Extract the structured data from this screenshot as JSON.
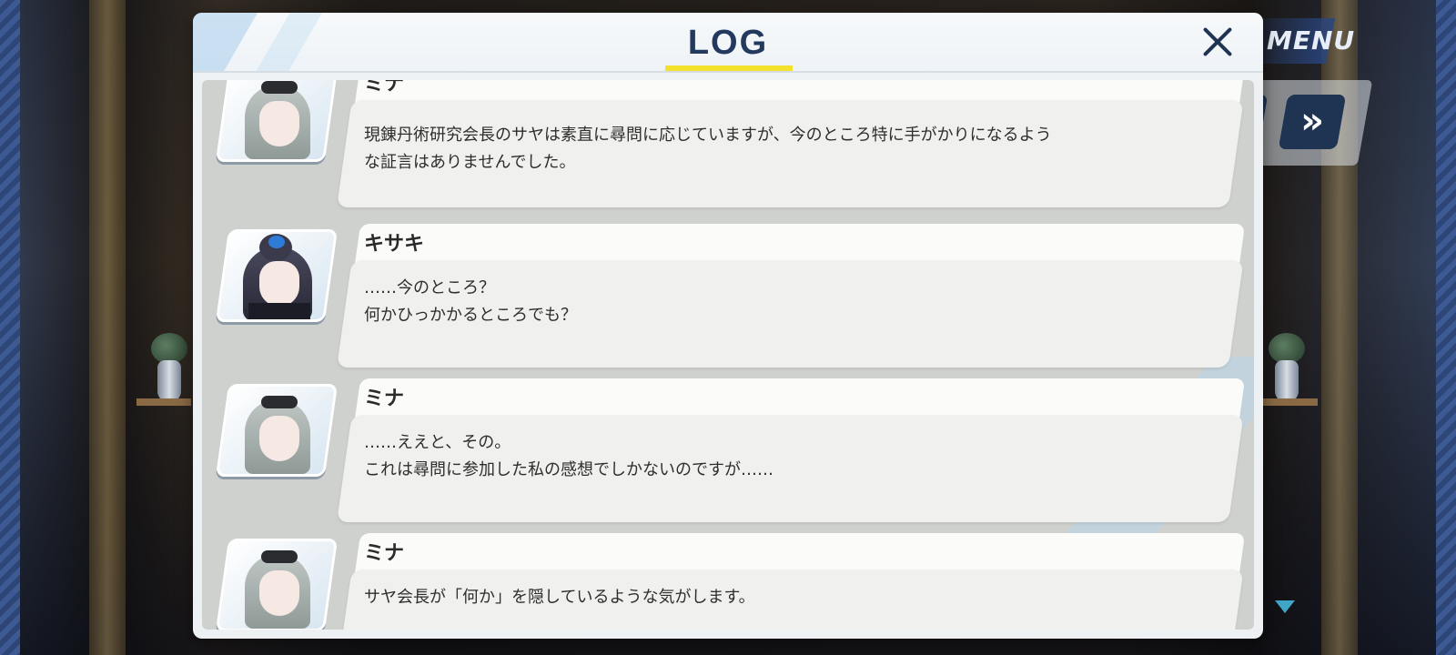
{
  "background": {
    "menu_label": "MENU",
    "fast_forward_glyph": "»"
  },
  "dialog": {
    "title": "LOG",
    "close_icon": "close-icon",
    "accent_color": "#f3e12e"
  },
  "log_entries": [
    {
      "speaker": "ミナ",
      "portrait": "mina",
      "lines": [
        "現錬丹術研究会長のサヤは素直に尋問に応じていますが、今のところ特に手がかりになるよう",
        "な証言はありませんでした。"
      ]
    },
    {
      "speaker": "キサキ",
      "portrait": "kisaki",
      "lines": [
        "……今のところ？",
        "何かひっかかるところでも？"
      ]
    },
    {
      "speaker": "ミナ",
      "portrait": "mina",
      "lines": [
        "……ええと、その。",
        "これは尋問に参加した私の感想でしかないのですが……"
      ]
    },
    {
      "speaker": "ミナ",
      "portrait": "mina",
      "lines": [
        "サヤ会長が「何か」を隠しているような気がします。"
      ]
    }
  ]
}
